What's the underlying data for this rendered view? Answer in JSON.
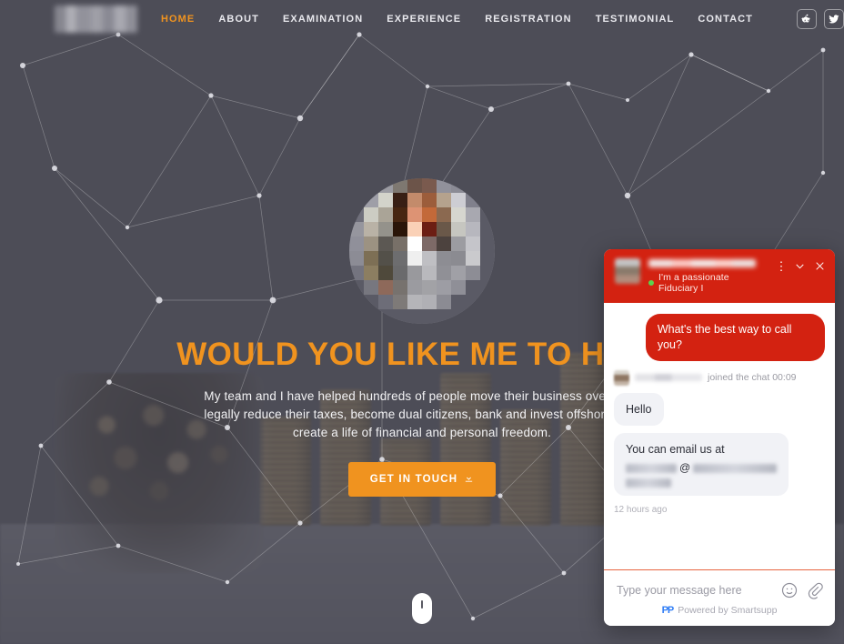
{
  "header": {
    "logo_alt": "site-logo-blurred",
    "nav": [
      {
        "label": "HOME",
        "active": true
      },
      {
        "label": "ABOUT",
        "active": false
      },
      {
        "label": "EXAMINATION",
        "active": false
      },
      {
        "label": "EXPERIENCE",
        "active": false
      },
      {
        "label": "REGISTRATION",
        "active": false
      },
      {
        "label": "TESTIMONIAL",
        "active": false
      },
      {
        "label": "CONTACT",
        "active": false
      }
    ],
    "social": [
      {
        "name": "reddit-icon"
      },
      {
        "name": "twitter-icon"
      }
    ]
  },
  "hero": {
    "headline": "WOULD YOU LIKE ME TO HELP",
    "paragraph": "My team and I have helped hundreds of people move their business overseas, legally reduce their taxes, become dual citizens, bank and invest offshore, and create a life of financial and personal freedom.",
    "cta_label": "GET IN TOUCH",
    "cta_icon": "download-icon",
    "scroll_hint": "scroll-down-indicator",
    "accent_color": "#f0931f",
    "background_color": "#56565f"
  },
  "chat": {
    "accent_color": "#d32211",
    "agent_name": "",
    "agent_status": "I'm a passionate Fiduciary I",
    "status_online": true,
    "actions": [
      {
        "name": "kebab-menu-icon",
        "glyph": "⋮"
      },
      {
        "name": "chevron-down-icon"
      },
      {
        "name": "close-icon"
      }
    ],
    "messages": [
      {
        "type": "outgoing",
        "text": "What's the best way to call you?"
      },
      {
        "type": "system",
        "name": "",
        "text": "joined the chat 00:09"
      },
      {
        "type": "incoming",
        "text": "Hello"
      },
      {
        "type": "incoming",
        "text": "You can email us at",
        "email_redacted": true
      }
    ],
    "timestamp": "12 hours ago",
    "input_placeholder": "Type your message here",
    "input_value": "",
    "emoji_icon": "smiley-icon",
    "attach_icon": "paperclip-icon",
    "brand_mark": "PP",
    "brand_text": "Powered by Smartsupp"
  }
}
